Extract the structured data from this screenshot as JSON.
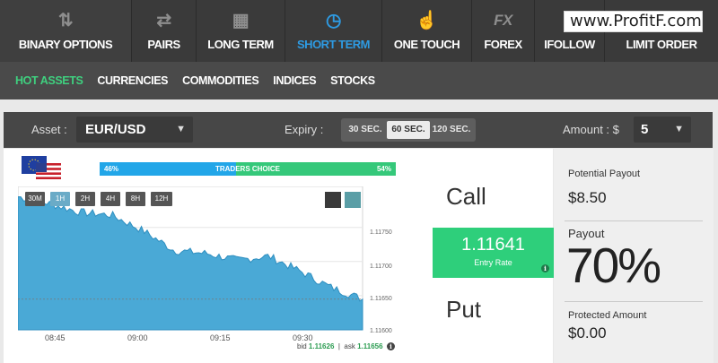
{
  "nav": {
    "items": [
      {
        "label": "BINARY OPTIONS",
        "icon": "arrows-updown-icon",
        "glyph": "⇅"
      },
      {
        "label": "PAIRS",
        "icon": "swap-arrows-icon",
        "glyph": "⇄"
      },
      {
        "label": "LONG TERM",
        "icon": "calendar-icon",
        "glyph": "▦"
      },
      {
        "label": "SHORT TERM",
        "icon": "stopwatch-icon",
        "glyph": "◷"
      },
      {
        "label": "ONE TOUCH",
        "icon": "pointer-hand-icon",
        "glyph": "☝"
      },
      {
        "label": "FOREX",
        "icon": "fx-icon",
        "glyph": "FX"
      },
      {
        "label": "IFOLLOW",
        "icon": "user-icon",
        "glyph": "●"
      },
      {
        "label": "LIMIT ORDER",
        "icon": "",
        "glyph": ""
      }
    ],
    "active_index": 3,
    "active_color": "#2e9be3"
  },
  "watermark": "www.ProfitF.com",
  "subnav": {
    "items": [
      "HOT ASSETS",
      "CURRENCIES",
      "COMMODITIES",
      "INDICES",
      "STOCKS"
    ],
    "active_color": "#3fd07f"
  },
  "controls": {
    "asset_label": "Asset :",
    "asset_value": "EUR/USD",
    "expiry_label": "Expiry :",
    "expiry_options": [
      "30 SEC.",
      "60 SEC.",
      "120 SEC."
    ],
    "expiry_selected": "60 SEC.",
    "amount_label": "Amount : $",
    "amount_value": "5"
  },
  "traders_choice": {
    "label": "TRADERS CHOICE",
    "left_pct": "46%",
    "right_pct": "54%"
  },
  "timeframes": [
    "30M",
    "1H",
    "2H",
    "4H",
    "8H",
    "12H"
  ],
  "timeframe_selected": "1H",
  "chart": {
    "time_labels": [
      "08:45",
      "09:00",
      "09:15",
      "09:30"
    ],
    "price_labels": [
      "1.11750",
      "1.11700",
      "1.11650",
      "1.11600"
    ],
    "bid_label": "bid",
    "bid_value": "1.11626",
    "ask_label": "ask",
    "ask_value": "1.11656",
    "fill_color": "#4aa9d6"
  },
  "chart_data": {
    "type": "area",
    "xlabel": "",
    "ylabel": "",
    "ylim": [
      1.116,
      1.1181
    ],
    "x": [
      "08:36",
      "08:45",
      "08:50",
      "09:00",
      "09:05",
      "09:10",
      "09:15",
      "09:20",
      "09:25",
      "09:30",
      "09:35",
      "09:38"
    ],
    "series": [
      {
        "values": [
          1.11795,
          1.11785,
          1.11772,
          1.11768,
          1.11745,
          1.11716,
          1.11712,
          1.11702,
          1.11708,
          1.11686,
          1.11662,
          1.11645
        ]
      }
    ]
  },
  "trade": {
    "call_label": "Call",
    "put_label": "Put",
    "entry_rate": "1.11641",
    "entry_label": "Entry Rate"
  },
  "payout": {
    "potential_label": "Potential Payout",
    "potential_value": "$8.50",
    "payout_label": "Payout",
    "payout_value": "70%",
    "protected_label": "Protected Amount",
    "protected_value": "$0.00"
  }
}
